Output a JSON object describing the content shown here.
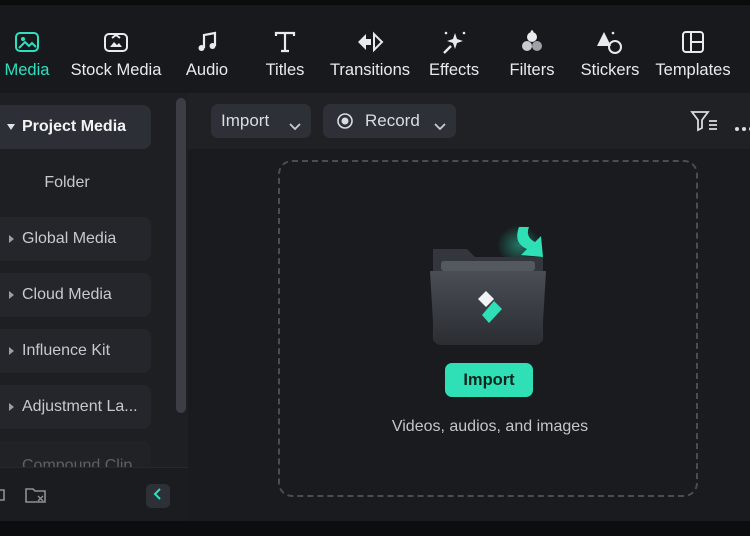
{
  "toolbar": {
    "items": [
      {
        "label": "Media",
        "icon": "media-icon",
        "active": true
      },
      {
        "label": "Stock Media",
        "icon": "stock-media-icon"
      },
      {
        "label": "Audio",
        "icon": "music-note-icon"
      },
      {
        "label": "Titles",
        "icon": "text-t-icon"
      },
      {
        "label": "Transitions",
        "icon": "transitions-icon"
      },
      {
        "label": "Effects",
        "icon": "effects-sparkle-icon"
      },
      {
        "label": "Filters",
        "icon": "filters-icon"
      },
      {
        "label": "Stickers",
        "icon": "stickers-icon"
      },
      {
        "label": "Templates",
        "icon": "templates-icon"
      }
    ]
  },
  "sidebar": {
    "items": [
      {
        "label": "Project Media",
        "active": true
      },
      {
        "label": "Folder"
      },
      {
        "label": "Global Media"
      },
      {
        "label": "Cloud Media"
      },
      {
        "label": "Influence Kit"
      },
      {
        "label": "Adjustment La..."
      },
      {
        "label": "Compound Clip"
      }
    ]
  },
  "panel": {
    "import_dropdown": "Import",
    "record_dropdown": "Record",
    "import_button": "Import",
    "hint": "Videos, audios, and images"
  },
  "colors": {
    "accent": "#2fe0c0",
    "button": "#2fe0b6",
    "background": "#1b1d21"
  }
}
